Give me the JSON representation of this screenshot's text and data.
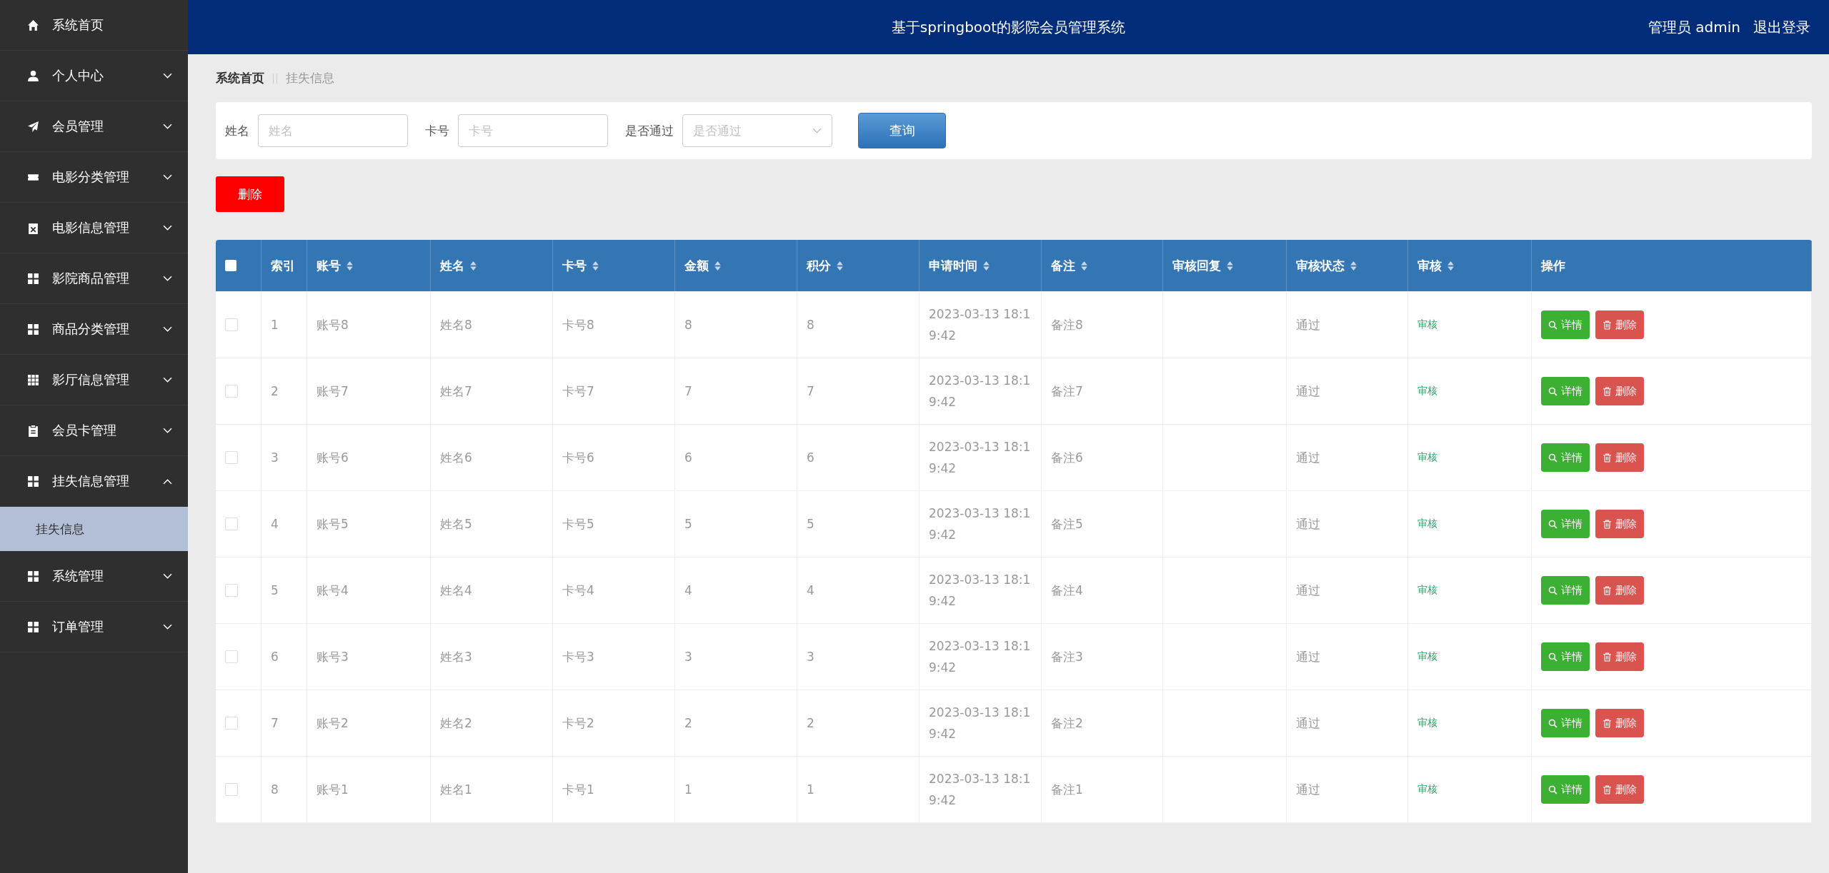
{
  "header": {
    "title": "基于springboot的影院会员管理系统",
    "user": "管理员 admin",
    "logout": "退出登录"
  },
  "sidebar": {
    "items": [
      {
        "label": "系统首页",
        "kind": "home"
      },
      {
        "label": "个人中心",
        "kind": "user",
        "expanded": false
      },
      {
        "label": "会员管理",
        "kind": "plane",
        "expanded": false
      },
      {
        "label": "电影分类管理",
        "kind": "ticket",
        "expanded": false
      },
      {
        "label": "电影信息管理",
        "kind": "clipx",
        "expanded": false
      },
      {
        "label": "影院商品管理",
        "kind": "grid4",
        "expanded": false
      },
      {
        "label": "商品分类管理",
        "kind": "grid4",
        "expanded": false
      },
      {
        "label": "影厅信息管理",
        "kind": "grid9",
        "expanded": false
      },
      {
        "label": "会员卡管理",
        "kind": "clip",
        "expanded": false
      },
      {
        "label": "挂失信息管理",
        "kind": "grid4",
        "expanded": true,
        "children": [
          {
            "label": "挂失信息",
            "selected": true
          }
        ]
      },
      {
        "label": "系统管理",
        "kind": "grid4",
        "expanded": false
      },
      {
        "label": "订单管理",
        "kind": "grid4",
        "expanded": false
      }
    ]
  },
  "breadcrumb": [
    "系统首页",
    "挂失信息"
  ],
  "search": {
    "fields": [
      {
        "label": "姓名",
        "placeholder": "姓名",
        "kind": "input"
      },
      {
        "label": "卡号",
        "placeholder": "卡号",
        "kind": "input"
      },
      {
        "label": "是否通过",
        "placeholder": "是否通过",
        "kind": "select"
      }
    ],
    "button": "查询"
  },
  "delete_button": "删除",
  "table": {
    "all_checked": false,
    "columns": [
      {
        "label": "索引",
        "sortable": false
      },
      {
        "label": "账号",
        "sortable": true
      },
      {
        "label": "姓名",
        "sortable": true
      },
      {
        "label": "卡号",
        "sortable": true
      },
      {
        "label": "金额",
        "sortable": true
      },
      {
        "label": "积分",
        "sortable": true
      },
      {
        "label": "申请时间",
        "sortable": true
      },
      {
        "label": "备注",
        "sortable": true
      },
      {
        "label": "审核回复",
        "sortable": true
      },
      {
        "label": "审核状态",
        "sortable": true
      },
      {
        "label": "审核",
        "sortable": true
      },
      {
        "label": "操作",
        "sortable": false
      }
    ],
    "rows": [
      {
        "checked": false,
        "cells": [
          "1",
          "账号8",
          "姓名8",
          "卡号8",
          "8",
          "8",
          "2023-03-13 18:19:42",
          "备注8",
          "",
          "通过"
        ],
        "review": "审核",
        "actions": [
          "详情",
          "删除"
        ]
      },
      {
        "checked": false,
        "cells": [
          "2",
          "账号7",
          "姓名7",
          "卡号7",
          "7",
          "7",
          "2023-03-13 18:19:42",
          "备注7",
          "",
          "通过"
        ],
        "review": "审核",
        "actions": [
          "详情",
          "删除"
        ]
      },
      {
        "checked": false,
        "cells": [
          "3",
          "账号6",
          "姓名6",
          "卡号6",
          "6",
          "6",
          "2023-03-13 18:19:42",
          "备注6",
          "",
          "通过"
        ],
        "review": "审核",
        "actions": [
          "详情",
          "删除"
        ]
      },
      {
        "checked": false,
        "cells": [
          "4",
          "账号5",
          "姓名5",
          "卡号5",
          "5",
          "5",
          "2023-03-13 18:19:42",
          "备注5",
          "",
          "通过"
        ],
        "review": "审核",
        "actions": [
          "详情",
          "删除"
        ]
      },
      {
        "checked": false,
        "cells": [
          "5",
          "账号4",
          "姓名4",
          "卡号4",
          "4",
          "4",
          "2023-03-13 18:19:42",
          "备注4",
          "",
          "通过"
        ],
        "review": "审核",
        "actions": [
          "详情",
          "删除"
        ]
      },
      {
        "checked": false,
        "cells": [
          "6",
          "账号3",
          "姓名3",
          "卡号3",
          "3",
          "3",
          "2023-03-13 18:19:42",
          "备注3",
          "",
          "通过"
        ],
        "review": "审核",
        "actions": [
          "详情",
          "删除"
        ]
      },
      {
        "checked": false,
        "cells": [
          "7",
          "账号2",
          "姓名2",
          "卡号2",
          "2",
          "2",
          "2023-03-13 18:19:42",
          "备注2",
          "",
          "通过"
        ],
        "review": "审核",
        "actions": [
          "详情",
          "删除"
        ]
      },
      {
        "checked": false,
        "cells": [
          "8",
          "账号1",
          "姓名1",
          "卡号1",
          "1",
          "1",
          "2023-03-13 18:19:42",
          "备注1",
          "",
          "通过"
        ],
        "review": "审核",
        "actions": [
          "详情",
          "删除"
        ]
      }
    ]
  }
}
